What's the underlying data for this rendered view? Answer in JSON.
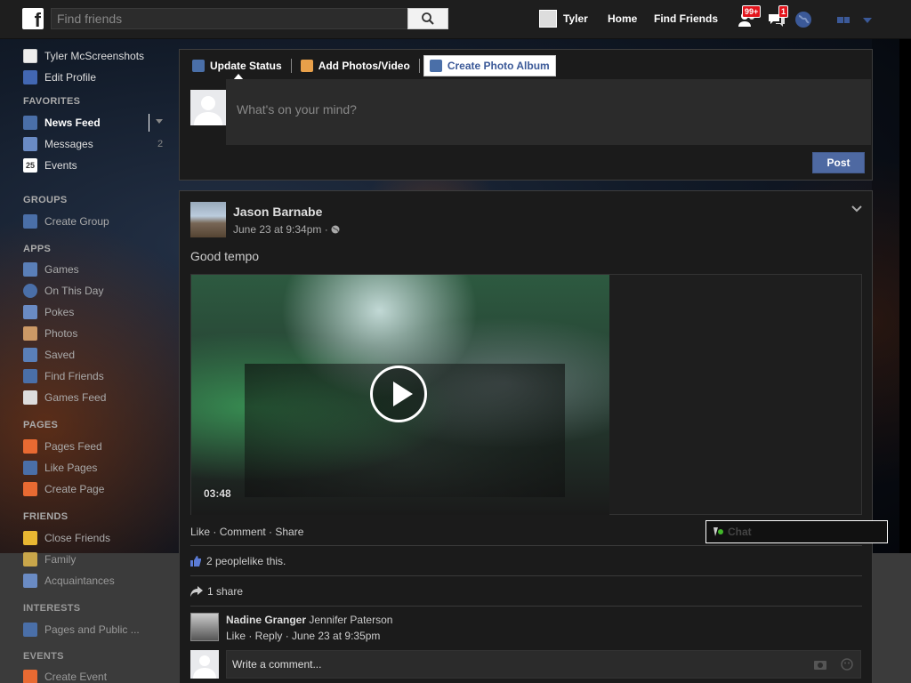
{
  "topbar": {
    "logo_letter": "f",
    "search_placeholder": "Find friends",
    "profile_name": "Tyler",
    "home_label": "Home",
    "find_friends_label": "Find Friends",
    "friend_requests_badge": "99+",
    "messages_badge": "1"
  },
  "sidebar": {
    "profile_name": "Tyler McScreenshots",
    "edit_profile": "Edit Profile",
    "favorites_header": "FAVORITES",
    "favorites": [
      {
        "label": "News Feed"
      },
      {
        "label": "Messages",
        "count": "2"
      },
      {
        "label": "Events",
        "icon_text": "25"
      }
    ],
    "groups_header": "GROUPS",
    "groups": [
      {
        "label": "Create Group"
      }
    ],
    "apps_header": "APPS",
    "apps": [
      {
        "label": "Games"
      },
      {
        "label": "On This Day"
      },
      {
        "label": "Pokes"
      },
      {
        "label": "Photos"
      },
      {
        "label": "Saved"
      },
      {
        "label": "Find Friends"
      },
      {
        "label": "Games Feed"
      }
    ],
    "pages_header": "PAGES",
    "pages": [
      {
        "label": "Pages Feed"
      },
      {
        "label": "Like Pages"
      },
      {
        "label": "Create Page"
      }
    ],
    "friends_header": "FRIENDS",
    "friends": [
      {
        "label": "Close Friends"
      },
      {
        "label": "Family"
      },
      {
        "label": "Acquaintances"
      }
    ],
    "interests_header": "INTERESTS",
    "interests": [
      {
        "label": "Pages and Public ..."
      }
    ],
    "events_header": "EVENTS",
    "events": [
      {
        "label": "Create Event"
      }
    ]
  },
  "composer": {
    "tabs": [
      "Update Status",
      "Add Photos/Video",
      "Create Photo Album"
    ],
    "placeholder": "What's on your mind?",
    "post_label": "Post"
  },
  "post": {
    "author": "Jason Barnabe",
    "time": "June 23 at 9:34pm · ",
    "text": "Good tempo",
    "video_duration": "03:48",
    "actions": {
      "like": "Like",
      "comment": "Comment",
      "share": "Share"
    },
    "likes_count": "2 people",
    "likes_suffix": " like this.",
    "shares_text": "1 share",
    "comment": {
      "author": "Nadine Granger",
      "text": "Jennifer Paterson",
      "actions": "Like · Reply · June 23 at 9:35pm"
    },
    "write_comment_placeholder": "Write a comment..."
  },
  "chat": {
    "label": "Chat"
  }
}
